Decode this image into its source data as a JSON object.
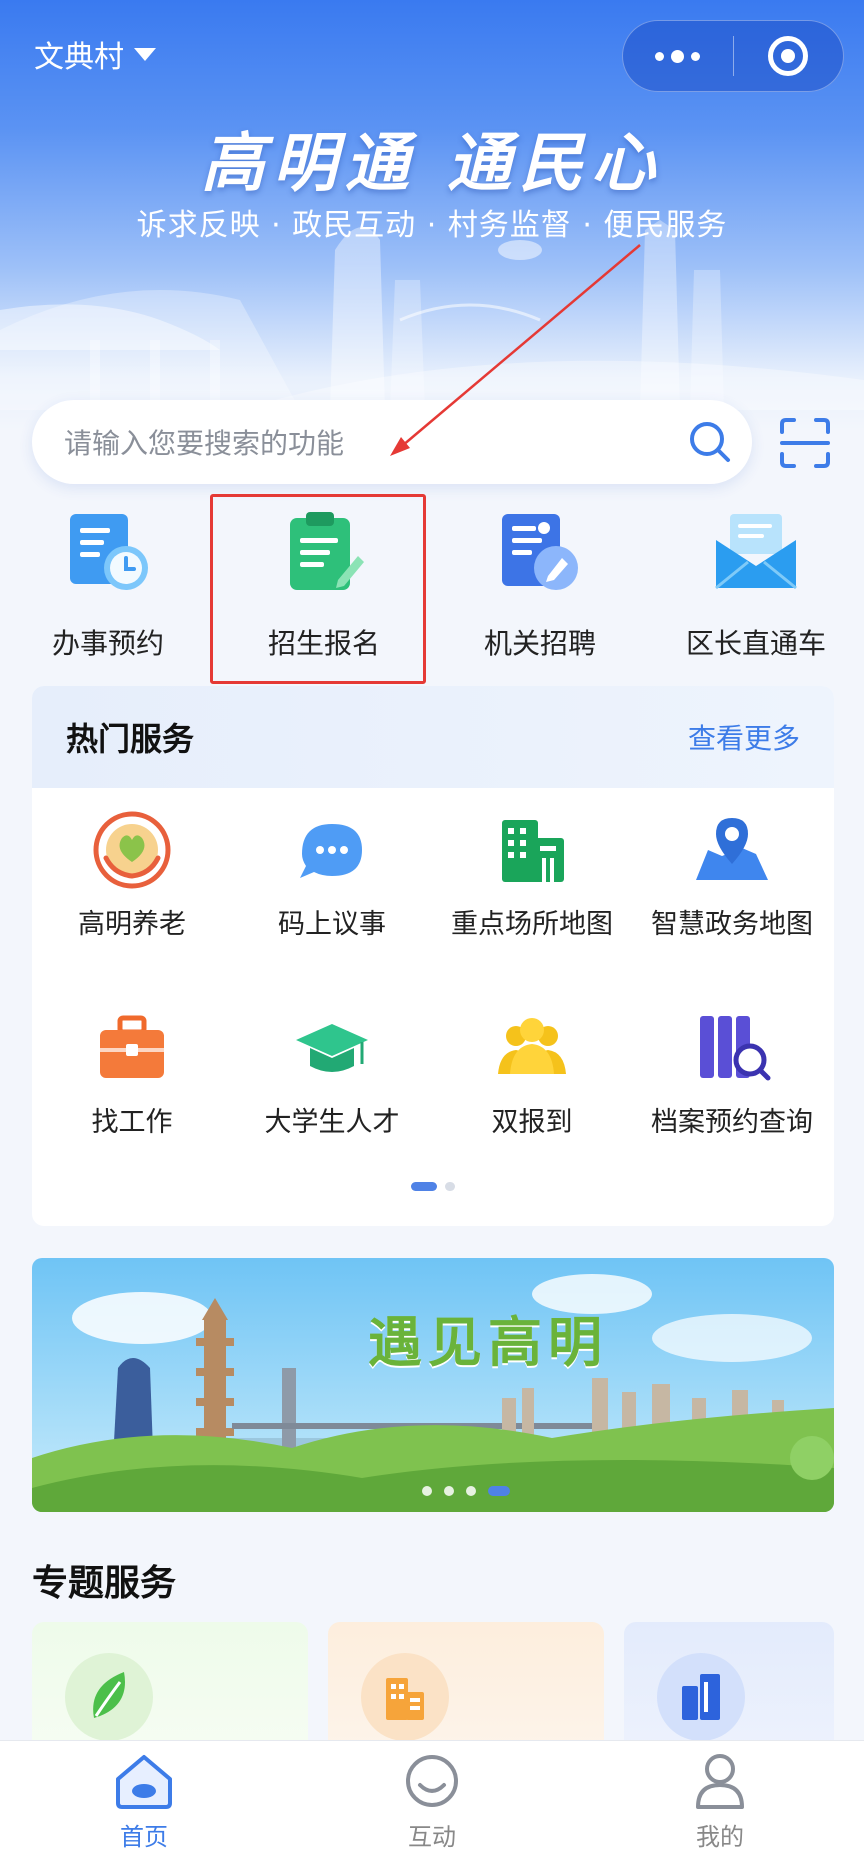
{
  "header": {
    "location": "文典村",
    "slogan": "高明通 通民心",
    "subslogan": "诉求反映 · 政民互动 · 村务监督 · 便民服务"
  },
  "search": {
    "placeholder": "请输入您要搜索的功能"
  },
  "quick_actions": [
    {
      "label": "办事预约",
      "icon": "appointment-icon"
    },
    {
      "label": "招生报名",
      "icon": "enrollment-clipboard-icon"
    },
    {
      "label": "机关招聘",
      "icon": "recruitment-icon"
    },
    {
      "label": "区长直通车",
      "icon": "mail-icon"
    }
  ],
  "hot_services": {
    "title": "热门服务",
    "more_label": "查看更多",
    "items": [
      {
        "label": "高明养老",
        "icon": "elderly-care-icon"
      },
      {
        "label": "码上议事",
        "icon": "chat-bubble-icon"
      },
      {
        "label": "重点场所地图",
        "icon": "building-icon"
      },
      {
        "label": "智慧政务地图",
        "icon": "map-pin-icon"
      },
      {
        "label": "找工作",
        "icon": "briefcase-icon"
      },
      {
        "label": "大学生人才",
        "icon": "graduation-cap-icon"
      },
      {
        "label": "双报到",
        "icon": "people-icon"
      },
      {
        "label": "档案预约查询",
        "icon": "archive-search-icon"
      }
    ]
  },
  "banner": {
    "title": "遇见高明"
  },
  "topic_services": {
    "title": "专题服务"
  },
  "tabbar": [
    {
      "label": "首页",
      "icon": "home-icon",
      "active": true
    },
    {
      "label": "互动",
      "icon": "interaction-icon",
      "active": false
    },
    {
      "label": "我的",
      "icon": "profile-icon",
      "active": false
    }
  ],
  "colors": {
    "primary": "#3d7ce8",
    "highlight_box": "#e53935"
  }
}
